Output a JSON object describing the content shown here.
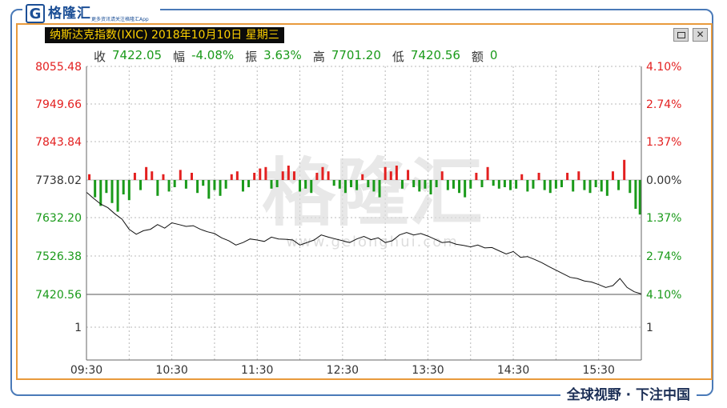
{
  "brand": {
    "logo_letter": "G",
    "name": "格隆汇",
    "slogan": "更多资讯请关注格隆汇App"
  },
  "window": {
    "title": "纳斯达克指数(IXIC) 2018年10月10日 星期三",
    "restore_label": "□",
    "close_label": "✕"
  },
  "stats": [
    {
      "label": "收",
      "value": "7422.05"
    },
    {
      "label": "幅",
      "value": "-4.08%"
    },
    {
      "label": "振",
      "value": "3.63%"
    },
    {
      "label": "高",
      "value": "7701.20"
    },
    {
      "label": "低",
      "value": "7420.56"
    },
    {
      "label": "额",
      "value": "0"
    }
  ],
  "footer_slogan": "全球视野 · 下注中国",
  "watermark": {
    "main": "格隆汇",
    "url": "www.gelonghui.com"
  },
  "colors": {
    "up": "#e32020",
    "down": "#1a9a1a",
    "line": "#111111",
    "grid": "#b8b8b8",
    "frame": "#4a7ab8",
    "panel_border": "#e89a3c"
  },
  "chart_data": {
    "type": "line",
    "left_axis_ticks": [
      "8055.48",
      "7949.66",
      "7843.84",
      "7738.02",
      "7632.20",
      "7526.38",
      "7420.56",
      "1"
    ],
    "right_axis_ticks": [
      "4.10%",
      "2.74%",
      "1.37%",
      "0.00%",
      "1.37%",
      "2.74%",
      "4.10%",
      "1"
    ],
    "x_ticks": [
      "09:30",
      "10:30",
      "11:30",
      "12:30",
      "13:30",
      "14:30",
      "15:30"
    ],
    "ylim": [
      7420.56,
      8055.48
    ],
    "reference_price": 7738.02,
    "x_range_minutes": [
      0,
      390
    ],
    "grid": true,
    "series": [
      {
        "type": "line",
        "x": [
          0,
          5,
          10,
          15,
          20,
          25,
          30,
          35,
          40,
          45,
          50,
          55,
          60,
          65,
          70,
          75,
          80,
          85,
          90,
          95,
          100,
          105,
          110,
          115,
          120,
          125,
          130,
          135,
          140,
          145,
          150,
          155,
          160,
          165,
          170,
          175,
          180,
          185,
          190,
          195,
          200,
          205,
          210,
          215,
          220,
          225,
          230,
          235,
          240,
          245,
          250,
          255,
          260,
          265,
          270,
          275,
          280,
          285,
          290,
          295,
          300,
          305,
          310,
          315,
          320,
          325,
          330,
          335,
          340,
          345,
          350,
          355,
          360,
          365,
          370,
          375,
          380,
          385,
          390
        ],
        "values": [
          7705,
          7688,
          7672,
          7662,
          7645,
          7630,
          7602,
          7588,
          7598,
          7602,
          7615,
          7605,
          7620,
          7615,
          7610,
          7612,
          7602,
          7595,
          7590,
          7578,
          7570,
          7558,
          7565,
          7575,
          7572,
          7568,
          7580,
          7575,
          7574,
          7572,
          7558,
          7565,
          7572,
          7586,
          7580,
          7575,
          7570,
          7565,
          7575,
          7582,
          7573,
          7578,
          7565,
          7570,
          7586,
          7593,
          7586,
          7590,
          7583,
          7574,
          7565,
          7567,
          7560,
          7557,
          7553,
          7558,
          7550,
          7551,
          7542,
          7533,
          7540,
          7524,
          7526,
          7518,
          7509,
          7498,
          7488,
          7478,
          7468,
          7465,
          7458,
          7455,
          7448,
          7440,
          7445,
          7465,
          7440,
          7428,
          7422
        ]
      }
    ],
    "volume_bars": [
      {
        "x": 2,
        "change": 0.4
      },
      {
        "x": 6,
        "change": -1.2
      },
      {
        "x": 10,
        "change": -1.8
      },
      {
        "x": 14,
        "change": -0.9
      },
      {
        "x": 18,
        "change": -1.6
      },
      {
        "x": 22,
        "change": -2.2
      },
      {
        "x": 26,
        "change": -1.0
      },
      {
        "x": 30,
        "change": -1.4
      },
      {
        "x": 34,
        "change": 0.5
      },
      {
        "x": 38,
        "change": -0.7
      },
      {
        "x": 42,
        "change": 0.9
      },
      {
        "x": 46,
        "change": 0.6
      },
      {
        "x": 50,
        "change": -1.1
      },
      {
        "x": 54,
        "change": 0.4
      },
      {
        "x": 58,
        "change": -0.8
      },
      {
        "x": 62,
        "change": -0.5
      },
      {
        "x": 66,
        "change": 0.7
      },
      {
        "x": 70,
        "change": -0.6
      },
      {
        "x": 74,
        "change": 0.5
      },
      {
        "x": 78,
        "change": -0.9
      },
      {
        "x": 82,
        "change": -0.4
      },
      {
        "x": 86,
        "change": -1.3
      },
      {
        "x": 90,
        "change": -0.7
      },
      {
        "x": 94,
        "change": -1.1
      },
      {
        "x": 98,
        "change": -0.6
      },
      {
        "x": 102,
        "change": 0.4
      },
      {
        "x": 106,
        "change": 0.6
      },
      {
        "x": 110,
        "change": -0.8
      },
      {
        "x": 114,
        "change": -0.5
      },
      {
        "x": 118,
        "change": 0.5
      },
      {
        "x": 122,
        "change": 0.8
      },
      {
        "x": 126,
        "change": 0.9
      },
      {
        "x": 130,
        "change": -0.6
      },
      {
        "x": 134,
        "change": -0.5
      },
      {
        "x": 138,
        "change": 0.6
      },
      {
        "x": 142,
        "change": 1.0
      },
      {
        "x": 146,
        "change": 0.6
      },
      {
        "x": 150,
        "change": -0.8
      },
      {
        "x": 154,
        "change": -0.6
      },
      {
        "x": 158,
        "change": -0.9
      },
      {
        "x": 162,
        "change": 0.5
      },
      {
        "x": 166,
        "change": 0.9
      },
      {
        "x": 170,
        "change": 0.6
      },
      {
        "x": 174,
        "change": -0.4
      },
      {
        "x": 178,
        "change": -0.6
      },
      {
        "x": 182,
        "change": -0.9
      },
      {
        "x": 186,
        "change": -0.5
      },
      {
        "x": 190,
        "change": -0.7
      },
      {
        "x": 194,
        "change": 0.4
      },
      {
        "x": 198,
        "change": -0.5
      },
      {
        "x": 202,
        "change": -0.8
      },
      {
        "x": 206,
        "change": -1.2
      },
      {
        "x": 210,
        "change": 0.9
      },
      {
        "x": 214,
        "change": 0.6
      },
      {
        "x": 218,
        "change": 1.0
      },
      {
        "x": 222,
        "change": -0.6
      },
      {
        "x": 226,
        "change": 0.7
      },
      {
        "x": 230,
        "change": -0.5
      },
      {
        "x": 234,
        "change": -0.8
      },
      {
        "x": 238,
        "change": -0.6
      },
      {
        "x": 242,
        "change": -1.0
      },
      {
        "x": 246,
        "change": -0.5
      },
      {
        "x": 250,
        "change": 0.6
      },
      {
        "x": 254,
        "change": -0.7
      },
      {
        "x": 258,
        "change": -0.6
      },
      {
        "x": 262,
        "change": -0.9
      },
      {
        "x": 266,
        "change": -1.2
      },
      {
        "x": 270,
        "change": -0.6
      },
      {
        "x": 274,
        "change": 0.5
      },
      {
        "x": 278,
        "change": -0.5
      },
      {
        "x": 282,
        "change": 0.9
      },
      {
        "x": 286,
        "change": -0.4
      },
      {
        "x": 290,
        "change": -0.6
      },
      {
        "x": 294,
        "change": -0.5
      },
      {
        "x": 298,
        "change": -0.7
      },
      {
        "x": 302,
        "change": -0.6
      },
      {
        "x": 306,
        "change": 0.4
      },
      {
        "x": 310,
        "change": -0.8
      },
      {
        "x": 314,
        "change": -0.6
      },
      {
        "x": 318,
        "change": 0.5
      },
      {
        "x": 322,
        "change": -0.7
      },
      {
        "x": 326,
        "change": -0.9
      },
      {
        "x": 330,
        "change": -0.6
      },
      {
        "x": 334,
        "change": -0.5
      },
      {
        "x": 338,
        "change": 0.5
      },
      {
        "x": 342,
        "change": -0.8
      },
      {
        "x": 346,
        "change": 0.6
      },
      {
        "x": 350,
        "change": -0.7
      },
      {
        "x": 354,
        "change": -0.9
      },
      {
        "x": 358,
        "change": -0.5
      },
      {
        "x": 362,
        "change": -0.8
      },
      {
        "x": 366,
        "change": -1.1
      },
      {
        "x": 370,
        "change": 0.6
      },
      {
        "x": 374,
        "change": -0.7
      },
      {
        "x": 378,
        "change": 1.4
      },
      {
        "x": 382,
        "change": -0.9
      },
      {
        "x": 386,
        "change": -2.0
      },
      {
        "x": 389,
        "change": -2.4
      }
    ]
  }
}
